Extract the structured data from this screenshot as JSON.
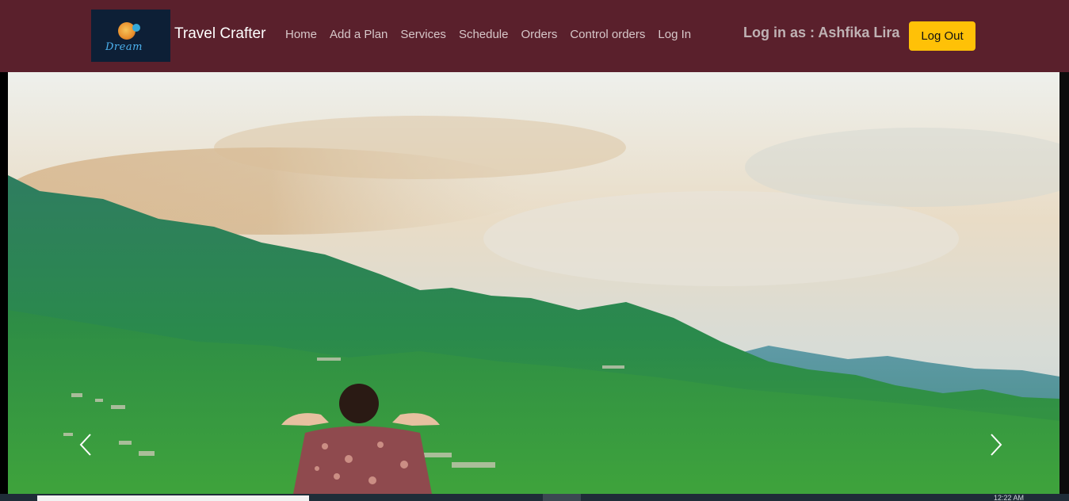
{
  "navbar": {
    "brand": {
      "logo_text": "Dream",
      "name": "Travel Crafter"
    },
    "links": [
      {
        "id": "home",
        "label": "Home"
      },
      {
        "id": "add-a-plan",
        "label": "Add a Plan"
      },
      {
        "id": "services",
        "label": "Services"
      },
      {
        "id": "schedule",
        "label": "Schedule"
      },
      {
        "id": "orders",
        "label": "Orders"
      },
      {
        "id": "control-orders",
        "label": "Control orders"
      },
      {
        "id": "log-in",
        "label": "Log In"
      }
    ],
    "login_status": "Log in as : Ashfika Lira",
    "logout_label": "Log Out"
  },
  "carousel": {
    "prev_icon": "chevron-left-icon",
    "next_icon": "chevron-right-icon"
  },
  "taskbar": {
    "clock": "12:22 AM"
  },
  "colors": {
    "navbar_bg": "#5a202c",
    "logout_bg": "#ffc107",
    "nav_link": "#d7c7c9"
  }
}
